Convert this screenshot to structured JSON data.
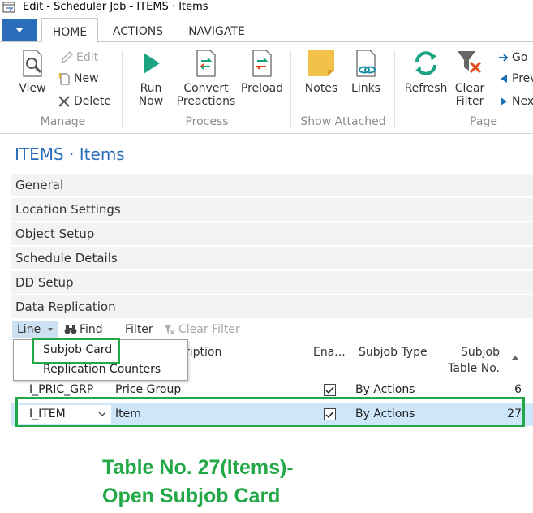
{
  "window": {
    "title": "Edit - Scheduler Job - ITEMS · Items"
  },
  "tabs": [
    {
      "label": "HOME"
    },
    {
      "label": "ACTIONS"
    },
    {
      "label": "NAVIGATE"
    }
  ],
  "ribbon": {
    "manage": {
      "label": "Manage",
      "view": "View",
      "edit": "Edit",
      "new": "New",
      "delete": "Delete"
    },
    "process": {
      "label": "Process",
      "run_now": [
        "Run",
        "Now"
      ],
      "convert": [
        "Convert",
        "Preactions"
      ],
      "preload": "Preload"
    },
    "show_attached": {
      "label": "Show Attached",
      "notes": "Notes",
      "links": "Links"
    },
    "page": {
      "label": "Page",
      "refresh": "Refresh",
      "clear_filter": [
        "Clear",
        "Filter"
      ],
      "go": "Go",
      "previous": "Prev",
      "next": "Nex"
    }
  },
  "page_title": "ITEMS · Items",
  "fasttabs": [
    "General",
    "Location Settings",
    "Object Setup",
    "Schedule Details",
    "DD Setup",
    "Data Replication"
  ],
  "subpage_toolbar": {
    "line": "Line",
    "find": "Find",
    "filter": "Filter",
    "clear_filter": "Clear Filter"
  },
  "dropdown": {
    "items": [
      "Subjob Card",
      "Replication Counters"
    ]
  },
  "grid": {
    "headers": {
      "description": "ription",
      "enabled": "Ena...",
      "subjob_type": "Subjob Type",
      "table_no": [
        "Subjob",
        "Table No."
      ]
    },
    "rows": [
      {
        "code": "I_PRIC_GRP",
        "description": "Price Group",
        "enabled": true,
        "subjob_type": "By Actions",
        "table_no": "6"
      },
      {
        "code": "I_ITEM",
        "description": "Item",
        "enabled": true,
        "subjob_type": "By Actions",
        "table_no": "27"
      }
    ]
  },
  "annotation": [
    "Table No. 27(Items)-",
    "Open Subjob Card"
  ],
  "colors": {
    "accent": "#2a6ebb",
    "highlight": "#22a846",
    "selected_row": "#cde6fa"
  }
}
